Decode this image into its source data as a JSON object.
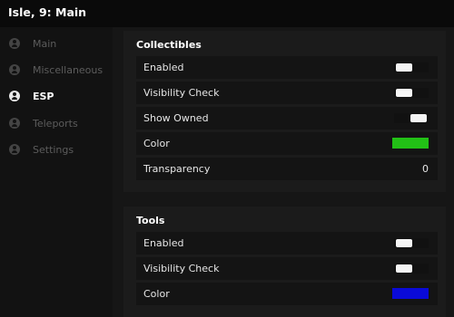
{
  "window": {
    "title": "Isle, 9: Main"
  },
  "sidebar": {
    "items": [
      {
        "label": "Main",
        "icon": "user-circle-icon",
        "active": false
      },
      {
        "label": "Miscellaneous",
        "icon": "user-circle-icon",
        "active": false
      },
      {
        "label": "ESP",
        "icon": "user-circle-icon",
        "active": true
      },
      {
        "label": "Teleports",
        "icon": "user-circle-icon",
        "active": false
      },
      {
        "label": "Settings",
        "icon": "user-circle-icon",
        "active": false
      }
    ]
  },
  "sections": [
    {
      "title": "Collectibles",
      "rows": [
        {
          "label": "Enabled",
          "type": "toggle",
          "value": false
        },
        {
          "label": "Visibility Check",
          "type": "toggle",
          "value": false
        },
        {
          "label": "Show Owned",
          "type": "toggle",
          "value": true
        },
        {
          "label": "Color",
          "type": "color",
          "value": "#22c016"
        },
        {
          "label": "Transparency",
          "type": "number",
          "value": "0"
        }
      ]
    },
    {
      "title": "Tools",
      "rows": [
        {
          "label": "Enabled",
          "type": "toggle",
          "value": false
        },
        {
          "label": "Visibility Check",
          "type": "toggle",
          "value": false
        },
        {
          "label": "Color",
          "type": "color",
          "value": "#0a0ad8"
        }
      ]
    }
  ],
  "colors": {
    "background": "#121212",
    "panel": "#1b1b1b",
    "row": "#141414",
    "accent_text": "#ffffff",
    "inactive_text": "#5c5c5c"
  }
}
